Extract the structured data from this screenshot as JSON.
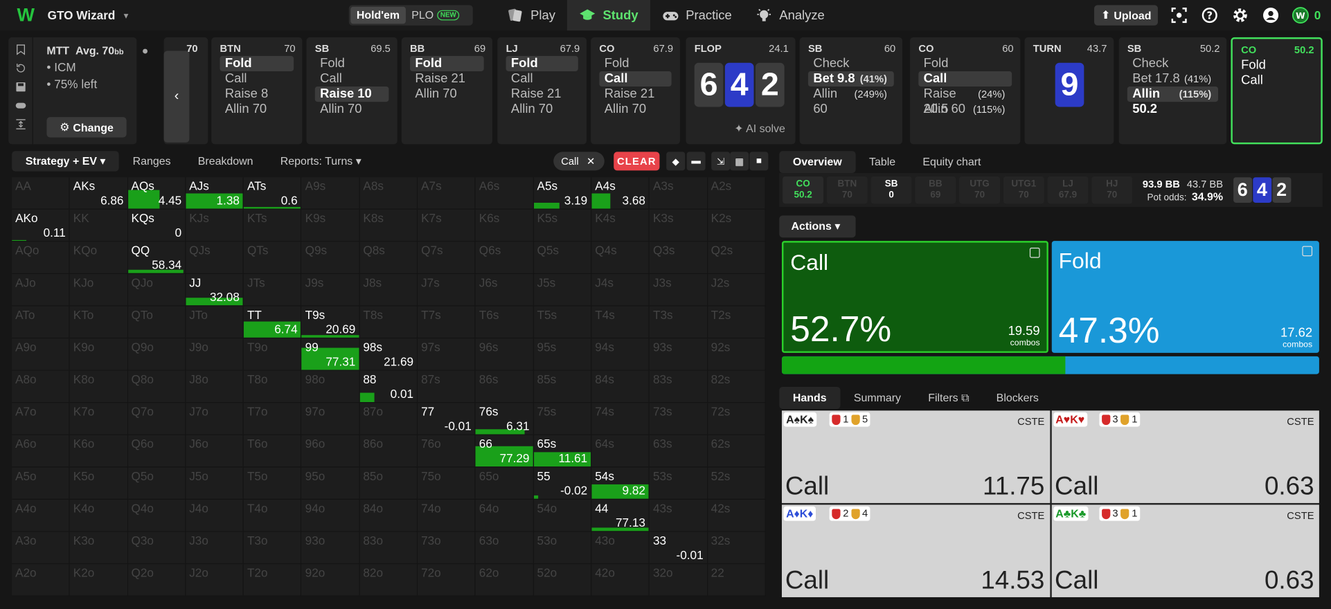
{
  "app": {
    "name": "GTO Wizard",
    "modes": [
      "Hold'em",
      "PLO"
    ],
    "new_badge": "NEW"
  },
  "nav": [
    "Play",
    "Study",
    "Practice",
    "Analyze"
  ],
  "upload": "Upload",
  "coins": "0",
  "mtt": {
    "title": "MTT",
    "avg": "Avg. 70",
    "avg_unit": "bb",
    "lines": [
      "ICM",
      "75% left"
    ],
    "change": "Change"
  },
  "prev_stack": "70",
  "cols": [
    {
      "pos": "BTN",
      "amt": "70",
      "actions": [
        "Fold",
        "Call",
        "Raise 8",
        "Allin 70"
      ],
      "sel": 0
    },
    {
      "pos": "SB",
      "amt": "69.5",
      "actions": [
        "Fold",
        "Call",
        "Raise 10",
        "Allin 70"
      ],
      "sel": 2
    },
    {
      "pos": "BB",
      "amt": "69",
      "actions": [
        "Fold",
        "Raise 21",
        "Allin 70"
      ],
      "sel": 0
    },
    {
      "pos": "LJ",
      "amt": "67.9",
      "actions": [
        "Fold",
        "Call",
        "Raise 21",
        "Allin 70"
      ],
      "sel": 0
    },
    {
      "pos": "CO",
      "amt": "67.9",
      "actions": [
        "Fold",
        "Call",
        "Raise 21",
        "Allin 70"
      ],
      "sel": 1
    }
  ],
  "flop": {
    "label": "FLOP",
    "pot": "24.1",
    "cards": [
      "6",
      "4",
      "2"
    ],
    "ai": "AI solve"
  },
  "flopcols": [
    {
      "pos": "SB",
      "amt": "60",
      "actions": [
        "Check",
        "Bet 9.8",
        "Allin 60"
      ],
      "pcts": [
        "",
        "(41%)",
        "(249%)"
      ],
      "sel": 1
    },
    {
      "pos": "CO",
      "amt": "60",
      "actions": [
        "Fold",
        "Call",
        "Raise 20.5",
        "Allin 60"
      ],
      "pcts": [
        "",
        "",
        "(24%)",
        "(115%)"
      ],
      "sel": 1
    }
  ],
  "turn": {
    "label": "TURN",
    "pot": "43.7",
    "card": "9"
  },
  "turncol": {
    "pos": "SB",
    "amt": "50.2",
    "actions": [
      "Check",
      "Bet 17.8",
      "Allin 50.2"
    ],
    "pcts": [
      "",
      "(41%)",
      "(115%)"
    ],
    "sel": 2
  },
  "curcol": {
    "pos": "CO",
    "amt": "50.2",
    "actions": [
      "Fold",
      "Call"
    ]
  },
  "lefttabs": [
    "Strategy + EV",
    "Ranges",
    "Breakdown",
    "Reports: Turns"
  ],
  "chip": "Call",
  "clear": "CLEAR",
  "matrix": [
    [
      "AA",
      "AKs",
      "AQs",
      "AJs",
      "ATs",
      "A9s",
      "A8s",
      "A7s",
      "A6s",
      "A5s",
      "A4s",
      "A3s",
      "A2s"
    ],
    [
      "AKo",
      "KK",
      "KQs",
      "KJs",
      "KTs",
      "K9s",
      "K8s",
      "K7s",
      "K6s",
      "K5s",
      "K4s",
      "K3s",
      "K2s"
    ],
    [
      "AQo",
      "KQo",
      "QQ",
      "QJs",
      "QTs",
      "Q9s",
      "Q8s",
      "Q7s",
      "Q6s",
      "Q5s",
      "Q4s",
      "Q3s",
      "Q2s"
    ],
    [
      "AJo",
      "KJo",
      "QJo",
      "JJ",
      "JTs",
      "J9s",
      "J8s",
      "J7s",
      "J6s",
      "J5s",
      "J4s",
      "J3s",
      "J2s"
    ],
    [
      "ATo",
      "KTo",
      "QTo",
      "JTo",
      "TT",
      "T9s",
      "T8s",
      "T7s",
      "T6s",
      "T5s",
      "T4s",
      "T3s",
      "T2s"
    ],
    [
      "A9o",
      "K9o",
      "Q9o",
      "J9o",
      "T9o",
      "99",
      "98s",
      "97s",
      "96s",
      "95s",
      "94s",
      "93s",
      "92s"
    ],
    [
      "A8o",
      "K8o",
      "Q8o",
      "J8o",
      "T8o",
      "98o",
      "88",
      "87s",
      "86s",
      "85s",
      "84s",
      "83s",
      "82s"
    ],
    [
      "A7o",
      "K7o",
      "Q7o",
      "J7o",
      "T7o",
      "97o",
      "87o",
      "77",
      "76s",
      "75s",
      "74s",
      "73s",
      "72s"
    ],
    [
      "A6o",
      "K6o",
      "Q6o",
      "J6o",
      "T6o",
      "96o",
      "86o",
      "76o",
      "66",
      "65s",
      "64s",
      "63s",
      "62s"
    ],
    [
      "A5o",
      "K5o",
      "Q5o",
      "J5o",
      "T5o",
      "95o",
      "85o",
      "75o",
      "65o",
      "55",
      "54s",
      "53s",
      "52s"
    ],
    [
      "A4o",
      "K4o",
      "Q4o",
      "J4o",
      "T4o",
      "94o",
      "84o",
      "74o",
      "64o",
      "54o",
      "44",
      "43s",
      "42s"
    ],
    [
      "A3o",
      "K3o",
      "Q3o",
      "J3o",
      "T3o",
      "93o",
      "83o",
      "73o",
      "63o",
      "53o",
      "43o",
      "33",
      "32s"
    ],
    [
      "A2o",
      "K2o",
      "Q2o",
      "J2o",
      "T2o",
      "92o",
      "82o",
      "72o",
      "62o",
      "52o",
      "42o",
      "32o",
      "22"
    ]
  ],
  "evs": {
    "AKs": {
      "ev": "6.86",
      "w": 0,
      "h": 0
    },
    "AQs": {
      "ev": "4.45",
      "w": 0.55,
      "h": 0.6
    },
    "AJs": {
      "ev": "1.38",
      "w": 1,
      "h": 0.5
    },
    "ATs": {
      "ev": "0.6",
      "w": 1,
      "h": 0.05
    },
    "A5s": {
      "ev": "3.19",
      "w": 0.45,
      "h": 0.2
    },
    "A4s": {
      "ev": "3.68",
      "w": 0.33,
      "h": 0.5
    },
    "AKo": {
      "ev": "0.11",
      "w": 0.25,
      "h": 0.04
    },
    "KQs": {
      "ev": "0",
      "w": 0,
      "h": 0
    },
    "QQ": {
      "ev": "58.34",
      "w": 0.97,
      "h": 0.1
    },
    "JJ": {
      "ev": "32.08",
      "w": 1,
      "h": 0.25
    },
    "TT": {
      "ev": "6.74",
      "w": 1,
      "h": 0.52
    },
    "T9s": {
      "ev": "20.69",
      "w": 1,
      "h": 0.07
    },
    "99": {
      "ev": "77.31",
      "w": 1,
      "h": 0.7
    },
    "98s": {
      "ev": "21.69",
      "w": 0,
      "h": 0
    },
    "88": {
      "ev": "0.01",
      "w": 0.25,
      "h": 0.3
    },
    "77": {
      "ev": "-0.01",
      "w": 0,
      "h": 0
    },
    "76s": {
      "ev": "6.31",
      "w": 0.85,
      "h": 0.15
    },
    "66": {
      "ev": "77.29",
      "w": 1,
      "h": 0.65
    },
    "65s": {
      "ev": "11.61",
      "w": 1,
      "h": 0.45
    },
    "55": {
      "ev": "-0.02",
      "w": 0.08,
      "h": 0.1
    },
    "54s": {
      "ev": "9.82",
      "w": 1,
      "h": 0.45
    },
    "44": {
      "ev": "77.13",
      "w": 1,
      "h": 0.1
    },
    "33": {
      "ev": "-0.01",
      "w": 0,
      "h": 0
    }
  },
  "righttabs": [
    "Overview",
    "Table",
    "Equity chart"
  ],
  "positions": [
    {
      "p": "CO",
      "v": "50.2",
      "state": "cur"
    },
    {
      "p": "BTN",
      "v": "70",
      "state": ""
    },
    {
      "p": "SB",
      "v": "0",
      "state": "hi"
    },
    {
      "p": "BB",
      "v": "69",
      "state": ""
    },
    {
      "p": "UTG",
      "v": "70",
      "state": ""
    },
    {
      "p": "UTG1",
      "v": "70",
      "state": ""
    },
    {
      "p": "LJ",
      "v": "67.9",
      "state": ""
    },
    {
      "p": "HJ",
      "v": "70",
      "state": ""
    }
  ],
  "pot": {
    "total": "93.9 BB",
    "pot": "43.7 BB",
    "odds_label": "Pot odds:",
    "odds": "34.9%"
  },
  "board": [
    "6",
    "4",
    "2"
  ],
  "actions_btn": "Actions",
  "call": {
    "name": "Call",
    "pct": "52.7%",
    "combos": "19.59",
    "combos_label": "combos",
    "freq": 0.527
  },
  "fold": {
    "name": "Fold",
    "pct": "47.3%",
    "combos": "17.62",
    "combos_label": "combos"
  },
  "handtabs": [
    "Hands",
    "Summary",
    "Filters",
    "Blockers"
  ],
  "hands": [
    {
      "cards": "A♠K♠",
      "cols": [
        "#222",
        "#222"
      ],
      "b1": "1",
      "b2": "5",
      "tag": "CSTE",
      "action": "Call",
      "ev": "11.75"
    },
    {
      "cards": "A♥K♥",
      "cols": [
        "#c41a1a",
        "#c41a1a"
      ],
      "b1": "3",
      "b2": "1",
      "tag": "CSTE",
      "action": "Call",
      "ev": "0.63"
    },
    {
      "cards": "A♦K♦",
      "cols": [
        "#2d4ed8",
        "#2d4ed8"
      ],
      "b1": "2",
      "b2": "4",
      "tag": "CSTE",
      "action": "Call",
      "ev": "14.53"
    },
    {
      "cards": "A♣K♣",
      "cols": [
        "#1a9a2a",
        "#1a9a2a"
      ],
      "b1": "3",
      "b2": "1",
      "tag": "CSTE",
      "action": "Call",
      "ev": "0.63"
    }
  ]
}
